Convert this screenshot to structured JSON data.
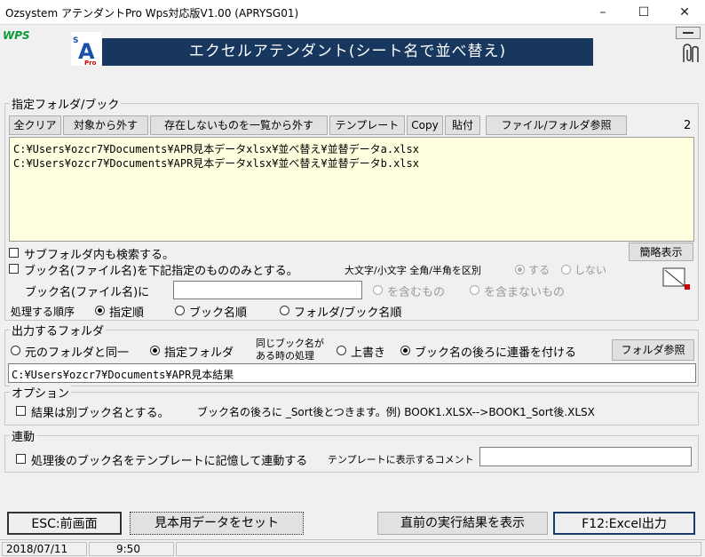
{
  "window": {
    "title": "Ozsystem アテンダントPro Wps対応版V1.00 (APRYSG01)",
    "minimize": "–",
    "maximize": "☐",
    "close": "✕"
  },
  "brand": {
    "wps_logo": "WPS",
    "logo_letters": "SAPro"
  },
  "banner": "エクセルアテンダント(シート名で並べ替え)",
  "folder_section": {
    "legend": "指定フォルダ/ブック",
    "buttons": {
      "clear_all": "全クリア",
      "remove": "対象から外す",
      "remove_missing": "存在しないものを一覧から外す",
      "template": "テンプレート",
      "copy": "Copy",
      "paste": "貼付",
      "browse": "ファイル/フォルダ参照"
    },
    "count": "2",
    "files": [
      "C:¥Users¥ozcr7¥Documents¥APR見本データxlsx¥並べ替え¥並替データa.xlsx",
      "C:¥Users¥ozcr7¥Documents¥APR見本データxlsx¥並べ替え¥並替データb.xlsx"
    ],
    "subfolder_label": "サブフォルダ内も検索する。",
    "book_filter_label": "ブック名(ファイル名)を下記指定のもののみとする。",
    "case_label": "大文字/小文字 全角/半角を区別",
    "radio_yes": "する",
    "radio_no": "しない",
    "summary_button": "簡略表示",
    "book_name_label": "ブック名(ファイル名)に",
    "book_name_value": "",
    "contains": "を含むもの",
    "not_contains": "を含まないもの",
    "order_label": "処理する順序",
    "order_specified": "指定順",
    "order_book": "ブック名順",
    "order_folder_book": "フォルダ/ブック名順"
  },
  "output_section": {
    "legend": "出力するフォルダ",
    "same_folder": "元のフォルダと同一",
    "specified_folder": "指定フォルダ",
    "same_name_line1": "同じブック名が",
    "same_name_line2": "ある時の処理",
    "overwrite": "上書き",
    "append_number": "ブック名の後ろに連番を付ける",
    "browse_button": "フォルダ参照",
    "path": "C:¥Users¥ozcr7¥Documents¥APR見本結果"
  },
  "options_section": {
    "legend": "オプション",
    "separate_book": "結果は別ブック名とする。",
    "note": "ブック名の後ろに _Sort後とつきます。例) BOOK1.XLSX-->BOOK1_Sort後.XLSX"
  },
  "link_section": {
    "legend": "連動",
    "remember": "処理後のブック名をテンプレートに記憶して連動する",
    "comment_label": "テンプレートに表示するコメント",
    "comment_value": ""
  },
  "bottom_buttons": {
    "back": "ESC:前画面",
    "sample": "見本用データをセット",
    "last_result": "直前の実行結果を表示",
    "excel_output": "F12:Excel出力"
  },
  "status": {
    "date": "2018/07/11",
    "time": "9:50"
  }
}
